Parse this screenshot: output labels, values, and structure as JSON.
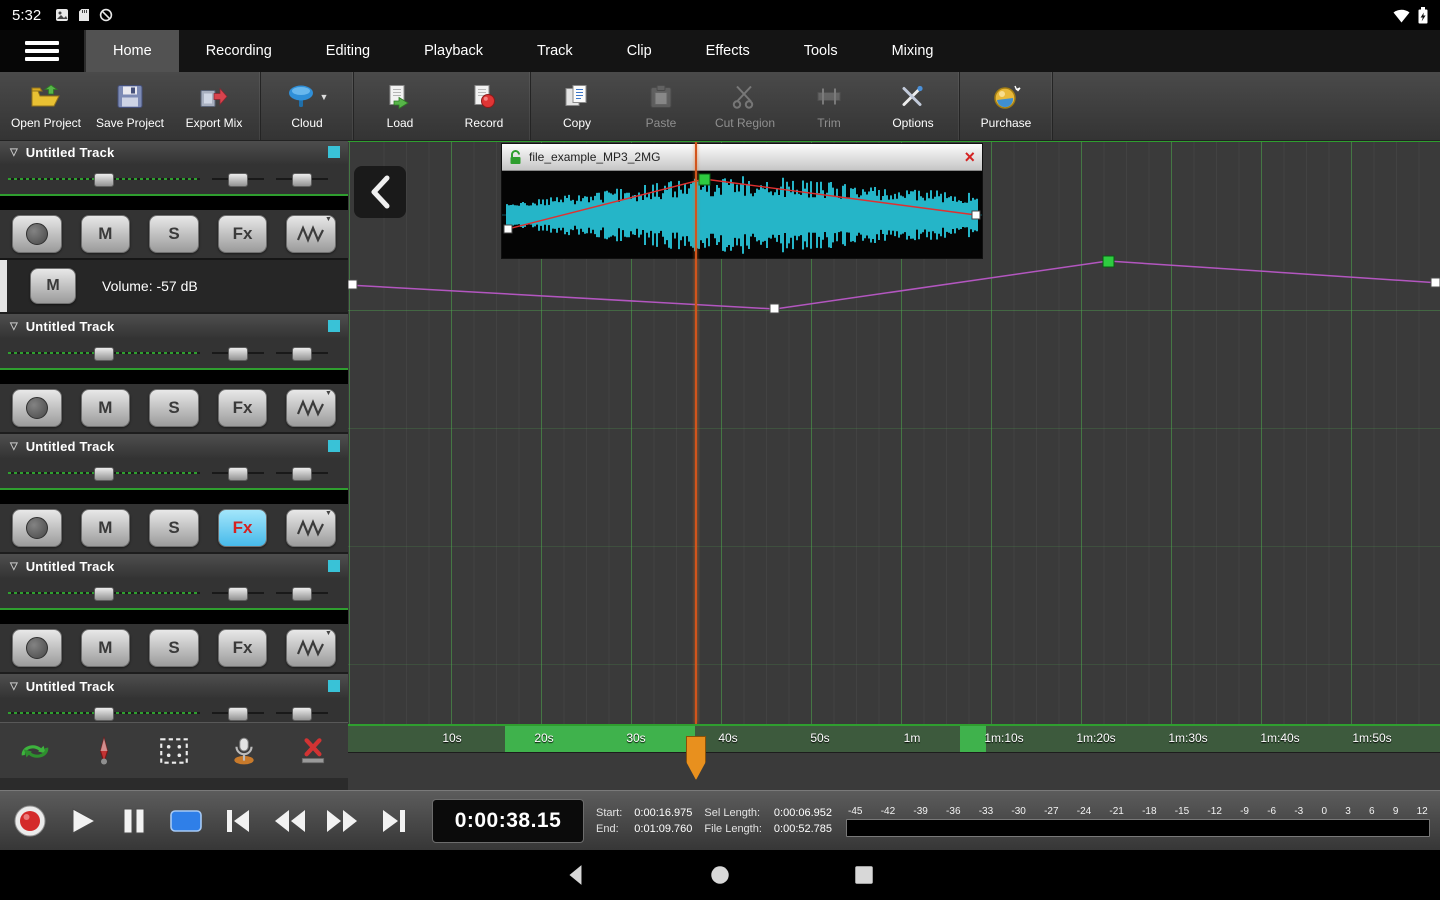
{
  "colors": {
    "accent_cyan": "#39c2d7",
    "waveform": "#25b5c8",
    "automation_line": "#b356c0",
    "playhead": "#e8901e",
    "selection_green": "#3fc24f",
    "fx_active_bg": "#47baea",
    "fx_active_text": "#d42222",
    "envelope_red": "#e03030"
  },
  "status_bar": {
    "time": "5:32",
    "icons": [
      "gallery-icon",
      "sd-card-icon",
      "circle-slash-icon"
    ],
    "right_icons": [
      "wifi-icon",
      "battery-icon"
    ]
  },
  "menu": {
    "tabs": [
      {
        "label": "Home",
        "active": true
      },
      {
        "label": "Recording",
        "active": false
      },
      {
        "label": "Editing",
        "active": false
      },
      {
        "label": "Playback",
        "active": false
      },
      {
        "label": "Track",
        "active": false
      },
      {
        "label": "Clip",
        "active": false
      },
      {
        "label": "Effects",
        "active": false
      },
      {
        "label": "Tools",
        "active": false
      },
      {
        "label": "Mixing",
        "active": false
      }
    ]
  },
  "toolbar": {
    "groups": [
      {
        "buttons": [
          {
            "label": "Open Project",
            "icon": "open-project-icon",
            "enabled": true
          },
          {
            "label": "Save Project",
            "icon": "save-project-icon",
            "enabled": true
          },
          {
            "label": "Export Mix",
            "icon": "export-mix-icon",
            "enabled": true
          }
        ]
      },
      {
        "buttons": [
          {
            "label": "Cloud",
            "icon": "cloud-icon",
            "enabled": true,
            "dropdown": true
          }
        ]
      },
      {
        "buttons": [
          {
            "label": "Load",
            "icon": "load-icon",
            "enabled": true
          },
          {
            "label": "Record",
            "icon": "record-doc-icon",
            "enabled": true
          }
        ]
      },
      {
        "buttons": [
          {
            "label": "Copy",
            "icon": "copy-icon",
            "enabled": true
          },
          {
            "label": "Paste",
            "icon": "paste-icon",
            "enabled": false
          },
          {
            "label": "Cut Region",
            "icon": "cut-region-icon",
            "enabled": false
          },
          {
            "label": "Trim",
            "icon": "trim-icon",
            "enabled": false
          },
          {
            "label": "Options",
            "icon": "options-icon",
            "enabled": true
          }
        ]
      },
      {
        "buttons": [
          {
            "label": "Purchase",
            "icon": "purchase-icon",
            "enabled": true
          }
        ]
      }
    ]
  },
  "tracks": [
    {
      "name": "Untitled Track",
      "mute": "M",
      "solo": "S",
      "fx": "Fx",
      "fx_active": false,
      "partial": false,
      "volume_row": {
        "mute": "M",
        "label": "Volume: -57 dB"
      }
    },
    {
      "name": "Untitled Track",
      "mute": "M",
      "solo": "S",
      "fx": "Fx",
      "fx_active": false,
      "partial": false
    },
    {
      "name": "Untitled Track",
      "mute": "M",
      "solo": "S",
      "fx": "Fx",
      "fx_active": true,
      "partial": false
    },
    {
      "name": "Untitled Track",
      "mute": "M",
      "solo": "S",
      "fx": "Fx",
      "fx_active": false,
      "partial": false
    },
    {
      "name": "Untitled Track",
      "mute": "M",
      "solo": "S",
      "fx": "Fx",
      "fx_active": false,
      "partial": true
    }
  ],
  "bottom_tools": [
    {
      "icon": "loop-tool-icon"
    },
    {
      "icon": "marker-tool-icon"
    },
    {
      "icon": "grid-tool-icon"
    },
    {
      "icon": "mic-tool-icon"
    },
    {
      "icon": "delete-tool-icon"
    }
  ],
  "clip": {
    "title": "file_example_MP3_2MG"
  },
  "ruler": {
    "labels": [
      "10s",
      "20s",
      "30s",
      "40s",
      "50s",
      "1m",
      "1m:10s",
      "1m:20s",
      "1m:30s",
      "1m:40s",
      "1m:50s"
    ]
  },
  "transport": {
    "time_display": "0:00:38.15",
    "buttons": [
      {
        "name": "record-button",
        "icon": "record-icon"
      },
      {
        "name": "play-button",
        "icon": "play-icon"
      },
      {
        "name": "pause-button",
        "icon": "pause-icon"
      },
      {
        "name": "stop-button",
        "icon": "stop-icon"
      },
      {
        "name": "skip-start-button",
        "icon": "skip-start-icon"
      },
      {
        "name": "rewind-button",
        "icon": "rewind-icon"
      },
      {
        "name": "fast-forward-button",
        "icon": "fast-forward-icon"
      },
      {
        "name": "skip-end-button",
        "icon": "skip-end-icon"
      }
    ],
    "info": [
      {
        "label": "Start:",
        "value": "0:00:16.975"
      },
      {
        "label": "End:",
        "value": "0:01:09.760"
      },
      {
        "label": "Sel Length:",
        "value": "0:00:06.952"
      },
      {
        "label": "File Length:",
        "value": "0:00:52.785"
      }
    ],
    "meter_scale": [
      "-45",
      "-42",
      "-39",
      "-36",
      "-33",
      "-30",
      "-27",
      "-24",
      "-21",
      "-18",
      "-15",
      "-12",
      "-9",
      "-6",
      "-3",
      "0",
      "3",
      "6",
      "9",
      "12"
    ]
  },
  "nav": {
    "icons": [
      "back-icon",
      "home-icon",
      "recents-icon"
    ]
  }
}
